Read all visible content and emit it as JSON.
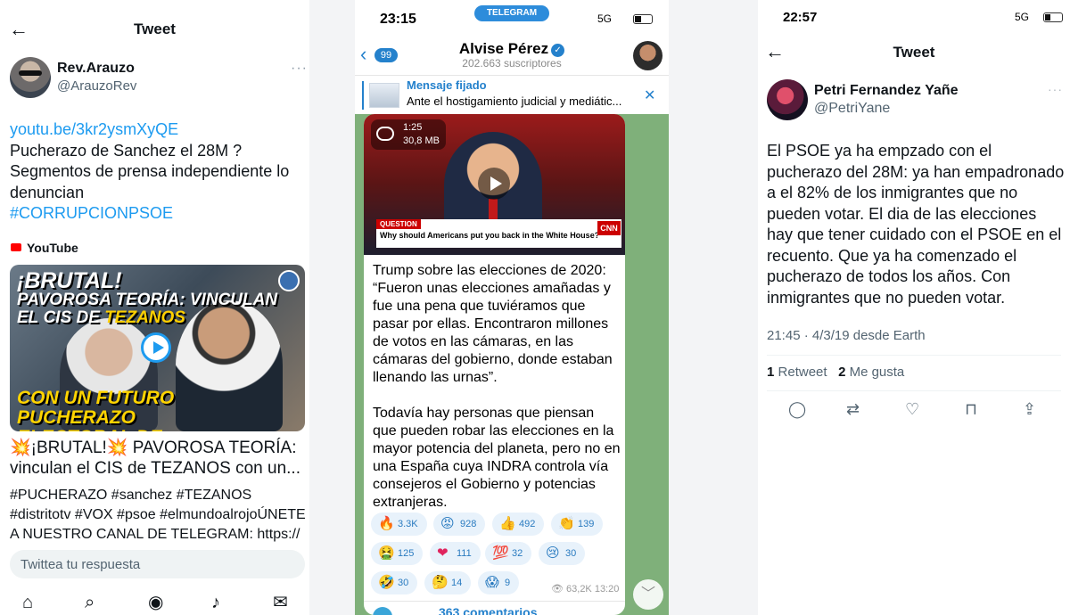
{
  "tweet1": {
    "header_title": "Tweet",
    "back_icon": "arrow-left-icon",
    "user_name": "Rev.Arauzo",
    "user_handle": "@ArauzoRev",
    "more_label": "···",
    "link": "youtu.be/3kr2ysmXyQE",
    "line1": "Pucherazo de Sanchez el 28M ?",
    "line2": "Segmentos de prensa independiente lo denuncian",
    "hashtag": "#CORRUPCIONPSOE",
    "source_label": "YouTube",
    "thumb": {
      "line1": "¡BRUTAL!",
      "line2": "PAVOROSA TEORÍA: VINCULAN",
      "line3a": "EL",
      "line3b": "CIS DE",
      "line3c": "TEZANOS",
      "line4": "CON UN FUTURO PUCHERAZO ELECTORAL DE SÁNCHEZ"
    },
    "card_title": "💥¡BRUTAL!💥 PAVOROSA TEORÍA: vinculan el CIS de TEZANOS con un...",
    "card_desc": "#PUCHERAZO #sanchez #TEZANOS #distritotv #VOX #psoe #elmundoalrojoÚNETE A NUESTRO CANAL DE TELEGRAM: https://",
    "reply_placeholder": "Twittea tu respuesta",
    "nav": {
      "home": "⌂",
      "search": "⌕",
      "spaces": "◉",
      "bell": "♪",
      "mail": "✉"
    }
  },
  "telegram": {
    "time": "23:15",
    "app_pill": "TELEGRAM",
    "network": "5G",
    "unread_count": "99",
    "channel_name": "Alvise Pérez",
    "verified_mark": "✓",
    "subscribers": "202.663 suscriptores",
    "pinned_label": "Mensaje fijado",
    "pinned_text": "Ante el hostigamiento judicial y mediátic...",
    "pinned_close": "✕",
    "video": {
      "duration": "1:25",
      "size": "30,8 MB",
      "question_tag": "QUESTION",
      "question_text": "Why should Americans put you back in the White House?",
      "network_logo": "CNN"
    },
    "message_p1": "Trump sobre las elecciones de 2020: “Fueron unas elecciones amañadas y fue una pena que tuviéramos que pasar por ellas. Encontraron millones de votos en las cámaras, en las cámaras del gobierno, donde estaban llenando las urnas”.",
    "message_p2": "Todavía hay personas que piensan que pueden robar las elecciones en la mayor potencia del planeta, pero no en una España cuya INDRA controla vía consejeros el Gobierno y potencias extranjeras.",
    "reactions": [
      {
        "emoji": "🔥",
        "count": "3.3K"
      },
      {
        "emoji": "😡",
        "count": "928"
      },
      {
        "emoji": "👍",
        "count": "492"
      },
      {
        "emoji": "👏",
        "count": "139"
      },
      {
        "emoji": "🤮",
        "count": "125"
      },
      {
        "emoji": "❤",
        "count": "111"
      },
      {
        "emoji": "💯",
        "count": "32"
      },
      {
        "emoji": "😢",
        "count": "30"
      },
      {
        "emoji": "🤣",
        "count": "30"
      },
      {
        "emoji": "🤔",
        "count": "14"
      },
      {
        "emoji": "😱",
        "count": "9"
      }
    ],
    "views_time": "👁 63,2K 13:20",
    "comments": "363 comentarios",
    "scroll_down": "﹀"
  },
  "tweet2": {
    "time": "22:57",
    "network": "5G",
    "header_title": "Tweet",
    "user_name": "Petri Fernandez Yañe",
    "user_handle": "@PetriYane",
    "more_label": "···",
    "body": "El PSOE ya ha empzado con el pucherazo del 28M: ya han empadronado a el 82% de los inmigrantes que no pueden votar. El dia de las elecciones hay que tener cuidado con el PSOE en el recuento. Que ya ha comenzado el pucherazo de todos los años. Con inmigrantes que no pueden votar.",
    "meta": "21:45 · 4/3/19 desde Earth",
    "retweets": "1",
    "retweets_label": "Retweet",
    "likes": "2",
    "likes_label": "Me gusta",
    "actions": {
      "reply": "◯",
      "retweet": "⇄",
      "like": "♡",
      "bookmark": "⊓",
      "share": "⇪"
    }
  }
}
